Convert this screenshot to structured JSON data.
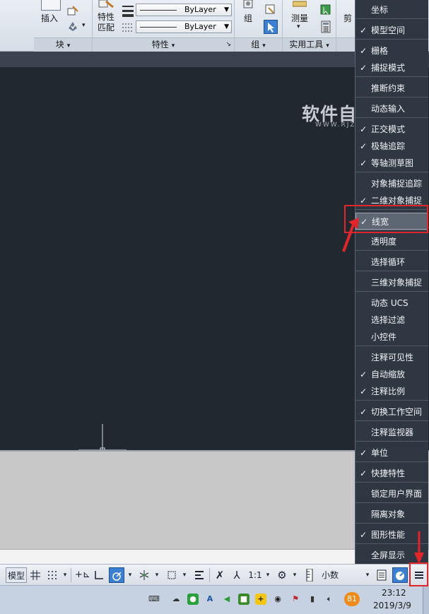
{
  "ribbon": {
    "insert_label": "插入",
    "block_panel": "块",
    "match_props_label": "特性\n匹配",
    "bylayer_1": "ByLayer",
    "bylayer_2": "ByLayer",
    "properties_panel": "特性",
    "group_label": "组",
    "group_panel": "组",
    "measure_label": "测量",
    "utilities_panel": "实用工具",
    "clipboard_label": "剪"
  },
  "watermark": {
    "main": "软件自学网",
    "sub": "WWW.RJZXW.COM"
  },
  "statusbar": {
    "model_label": "模型",
    "scale_label": "1:1",
    "units_label": "小数"
  },
  "taskbar": {
    "time": "23:12",
    "date": "2019/3/9",
    "badge": "81"
  },
  "menu": {
    "items": [
      {
        "label": "坐标",
        "checked": false
      },
      {
        "label": "模型空间",
        "checked": true
      },
      {
        "label": "栅格",
        "checked": true
      },
      {
        "label": "捕捉模式",
        "checked": true
      },
      {
        "label": "推断约束",
        "checked": false
      },
      {
        "label": "动态输入",
        "checked": false
      },
      {
        "label": "正交模式",
        "checked": true
      },
      {
        "label": "极轴追踪",
        "checked": true
      },
      {
        "label": "等轴测草图",
        "checked": true
      },
      {
        "label": "对象捕捉追踪",
        "checked": false
      },
      {
        "label": "二维对象捕捉",
        "checked": true
      },
      {
        "label": "线宽",
        "checked": true
      },
      {
        "label": "透明度",
        "checked": false
      },
      {
        "label": "选择循环",
        "checked": false
      },
      {
        "label": "三维对象捕捉",
        "checked": false
      },
      {
        "label": "动态 UCS",
        "checked": false
      },
      {
        "label": "选择过滤",
        "checked": false
      },
      {
        "label": "小控件",
        "checked": false
      },
      {
        "label": "注释可见性",
        "checked": false
      },
      {
        "label": "自动缩放",
        "checked": true
      },
      {
        "label": "注释比例",
        "checked": true
      },
      {
        "label": "切换工作空间",
        "checked": true
      },
      {
        "label": "注释监视器",
        "checked": false
      },
      {
        "label": "单位",
        "checked": true
      },
      {
        "label": "快捷特性",
        "checked": true
      },
      {
        "label": "锁定用户界面",
        "checked": false
      },
      {
        "label": "隔离对象",
        "checked": false
      },
      {
        "label": "图形性能",
        "checked": true
      },
      {
        "label": "全屏显示",
        "checked": false
      }
    ],
    "check_glyph": "✓"
  },
  "colors": {
    "menu_bg": "#2f3743",
    "canvas_bg": "#212830",
    "annotation_red": "#e0262a",
    "highlight_bg": "#5d6673"
  }
}
